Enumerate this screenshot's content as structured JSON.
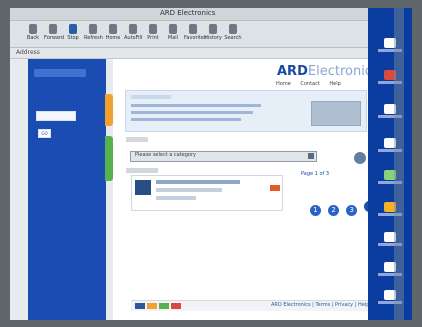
{
  "window": {
    "title": "ARD Electronics"
  },
  "toolbar": {
    "buttons": [
      {
        "label": "Back"
      },
      {
        "label": "Forward"
      },
      {
        "label": "Stop"
      },
      {
        "label": "Refresh"
      },
      {
        "label": "Home"
      },
      {
        "label": "AutoFill"
      },
      {
        "label": "Print"
      },
      {
        "label": "Mail"
      },
      {
        "label": "Favorites"
      },
      {
        "label": "History"
      },
      {
        "label": "Search"
      }
    ]
  },
  "address": {
    "text": "Address"
  },
  "leftbar": {
    "go_label": "GO"
  },
  "page": {
    "brand_part1": "ARD",
    "brand_part2": "Electro",
    "brand_part3": "nics",
    "brand_nav": [
      "Home",
      "Contact",
      "Help"
    ],
    "select_text": "Please select a category",
    "pager_label": "Page 1 of 3",
    "pager_numbers": [
      "1",
      "2",
      "3"
    ],
    "footer_text": "ARD Electronics | Terms | Privacy | Help"
  },
  "colors": {
    "leftbar_blue": "#1b4cb2",
    "rightbar_blue": "#0b3c9f",
    "orange_tab": "#f1a12f",
    "green_tab": "#56b24f",
    "accent": "#2a63c6"
  },
  "rightbar": {
    "items": [
      {
        "icon": "disk-icon"
      },
      {
        "icon": "tools-icon"
      },
      {
        "icon": "document-icon"
      },
      {
        "icon": "folder-icon"
      },
      {
        "icon": "settings-icon"
      },
      {
        "icon": "warning-icon"
      },
      {
        "icon": "app-icon"
      },
      {
        "icon": "clock-icon"
      },
      {
        "icon": "network-icon"
      }
    ]
  }
}
